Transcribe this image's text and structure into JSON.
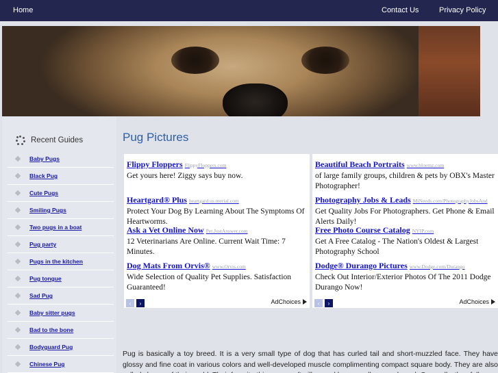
{
  "nav": {
    "home": "Home",
    "contact": "Contact Us",
    "privacy": "Privacy Policy"
  },
  "sidebar": {
    "heading": "Recent Guides",
    "icon": "spinner-dots-icon",
    "items": [
      {
        "label": "Baby Pugs"
      },
      {
        "label": "Black Pug"
      },
      {
        "label": "Cute Pugs"
      },
      {
        "label": "Smiling Pugs"
      },
      {
        "label": "Two pugs in a boat"
      },
      {
        "label": "Pug party"
      },
      {
        "label": "Pugs in the kitchen"
      },
      {
        "label": "Pug tongue"
      },
      {
        "label": "Sad Pug"
      },
      {
        "label": "Baby sitter pugs"
      },
      {
        "label": "Bad to the bone"
      },
      {
        "label": "Bodyguard Pug"
      },
      {
        "label": "Chinese Pug"
      }
    ]
  },
  "main": {
    "title": "Pug Pictures",
    "ads_left": [
      {
        "title": "Flippy Floppers",
        "url": "FlippyFloppers.com",
        "desc": "Get yours here! Ziggy says buy now."
      },
      {
        "title": "Heartgard® Plus",
        "url": "heartgard.us.merial.com",
        "desc": "Protect Your Dog By Learning About The Symptoms Of Heartworms."
      },
      {
        "title": "Ask a Vet Online Now",
        "url": "Pet.JustAnswer.com",
        "desc": "12 Veterinarians Are Online. Current Wait Time: 7 Minutes."
      },
      {
        "title": "Dog Mats From Orvis®",
        "url": "www.Orvis.com",
        "desc": "Wide Selection of Quality Pet Supplies. Satisfaction Guaranteed!"
      }
    ],
    "ads_right": [
      {
        "title": "Beautiful Beach Portraits",
        "url": "www.bloemz.com",
        "desc": "of large family groups, children & pets by OBX's Master Photographer!"
      },
      {
        "title": "Photography Jobs & Leads",
        "url": "MiNeeds.com/PhotographyJobsAnd",
        "desc": "Get Quality Jobs For Photographers. Get Phone & Email Alerts Daily!"
      },
      {
        "title": "Free Photo Course Catalog",
        "url": "NYIP.com",
        "desc": "Get A Free Catalog - The Nation's Oldest & Largest Photography School"
      },
      {
        "title": "Dodge® Durango Pictures",
        "url": "www.Dodge.com/Durango",
        "desc": "Check Out Interior/Exterior Photos Of The 2011 Dodge Durango Now!"
      }
    ],
    "adchoices": "AdChoices",
    "prev_arrow": "‹",
    "next_arrow": "›",
    "article": "Pug is basically a toy breed. It is a very small type of dog that has curled tail and short-muzzled face. They have glossy and fine coat in various colors and well-developed muscle complimenting compact square body. They are also called clowns of their world. Their favorite things are soft pillow and lap as well as good meal. Generally, they follow"
  },
  "colors": {
    "nav_bg": "#23264f",
    "title": "#2d5fa8",
    "link": "#1a1aa6",
    "ad_link": "#1414cc",
    "page_bg": "#dfe2e8"
  }
}
